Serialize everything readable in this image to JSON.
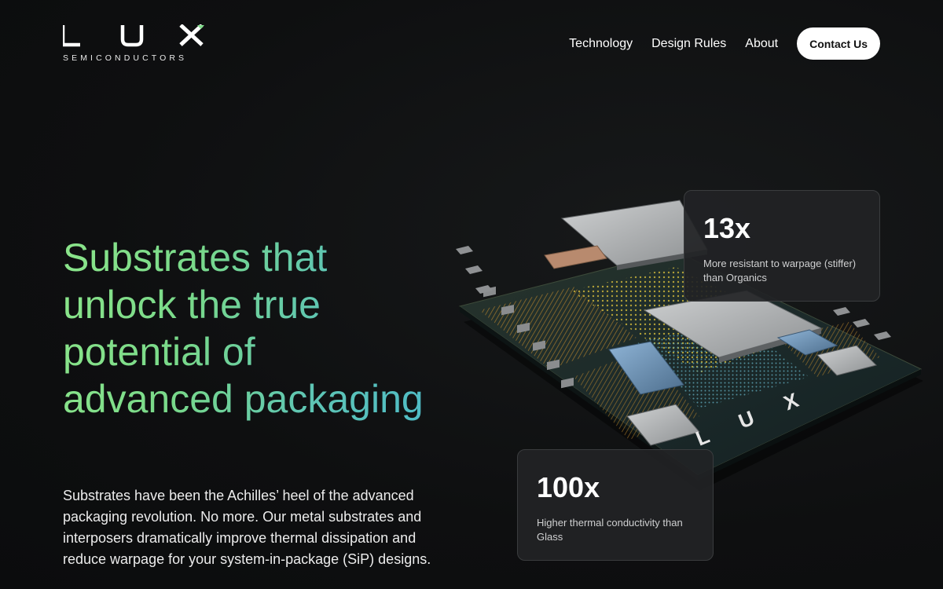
{
  "brand": {
    "logo_letters": "L U X",
    "tagline": "SEMICONDUCTORS",
    "accent_color": "#7fdc8a"
  },
  "nav": {
    "items": [
      {
        "label": "Technology"
      },
      {
        "label": "Design Rules"
      },
      {
        "label": "About"
      }
    ],
    "cta_label": "Contact Us"
  },
  "hero": {
    "title": "Substrates that unlock the true potential of advanced packaging",
    "description": "Substrates have been the Achilles’ heel of the advanced packaging revolution. No more. Our metal substrates and interposers dramatically improve thermal dissipation and reduce warpage for your system-in-package (SiP) designs.",
    "gradient_colors": [
      "#8be58a",
      "#4fbcc6"
    ]
  },
  "stats": [
    {
      "value": "13x",
      "label": "More resistant to warpage (stiffer) than Organics"
    },
    {
      "value": "100x",
      "label": "Higher thermal conductivity than Glass"
    }
  ],
  "illustration": {
    "chip_logo_text": "L U X"
  }
}
